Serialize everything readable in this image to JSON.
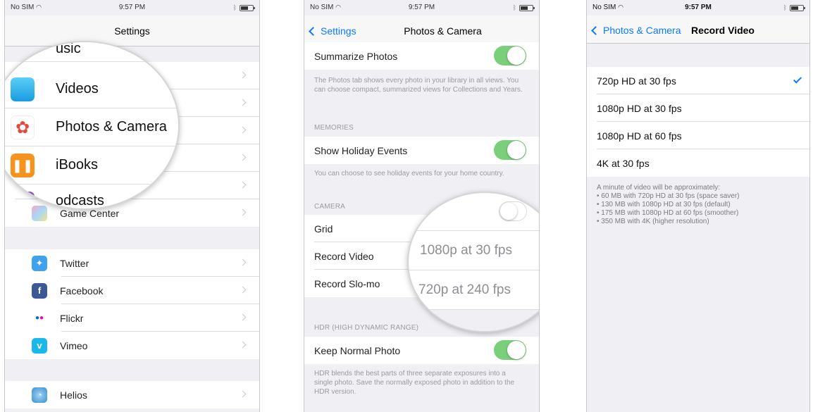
{
  "status": {
    "carrier": "No SIM",
    "time": "9:57 PM"
  },
  "screen1": {
    "title": "Settings",
    "rows": [
      {
        "label": "Game Center",
        "icon": "game-center-icon",
        "color": "#f0b0d8"
      },
      {
        "label": "Twitter",
        "icon": "twitter-icon",
        "color": "#40a2ef"
      },
      {
        "label": "Facebook",
        "icon": "facebook-icon",
        "color": "#3b5998"
      },
      {
        "label": "Flickr",
        "icon": "flickr-icon",
        "color": "#ffffff"
      },
      {
        "label": "Vimeo",
        "icon": "vimeo-icon",
        "color": "#1ab7ea"
      },
      {
        "label": "Helios",
        "icon": "helios-icon",
        "color": "#3a8fd0"
      }
    ],
    "magnifier": {
      "top_partial": "usic",
      "items": [
        "Videos",
        "Photos & Camera",
        "iBooks"
      ],
      "bottom_partial": "odcasts"
    }
  },
  "screen2": {
    "back": "Settings",
    "title": "Photos & Camera",
    "summarize_label": "Summarize Photos",
    "summarize_footer": "The Photos tab shows every photo in your library in all views. You can choose compact, summarized views for Collections and Years.",
    "memories_header": "MEMORIES",
    "holiday_label": "Show Holiday Events",
    "holiday_footer": "You can choose to see holiday events for your home country.",
    "camera_header": "CAMERA",
    "grid_label": "Grid",
    "record_video_label": "Record Video",
    "record_slomo_label": "Record Slo-mo",
    "record_video_value": "1080p at 30 fps",
    "record_slomo_value": "720p at 240 fps",
    "hdr_header": "HDR (HIGH DYNAMIC RANGE)",
    "keep_normal_label": "Keep Normal Photo",
    "hdr_footer": "HDR blends the best parts of three separate exposures into a single photo. Save the normally exposed photo in addition to the HDR version."
  },
  "screen3": {
    "back": "Photos & Camera",
    "title": "Record Video",
    "options": [
      "720p HD at 30 fps",
      "1080p HD at 30 fps",
      "1080p HD at 60 fps",
      "4K at 30 fps"
    ],
    "footer_lines": [
      "A minute of video will be approximately:",
      "• 60 MB with 720p HD at 30 fps (space saver)",
      "• 130 MB with 1080p HD at 30 fps (default)",
      "• 175 MB with 1080p HD at 60 fps (smoother)",
      "• 350 MB with 4K (higher resolution)"
    ]
  },
  "colors": {
    "accent": "#0a7aff",
    "toggle_on": "#7ad07a"
  }
}
